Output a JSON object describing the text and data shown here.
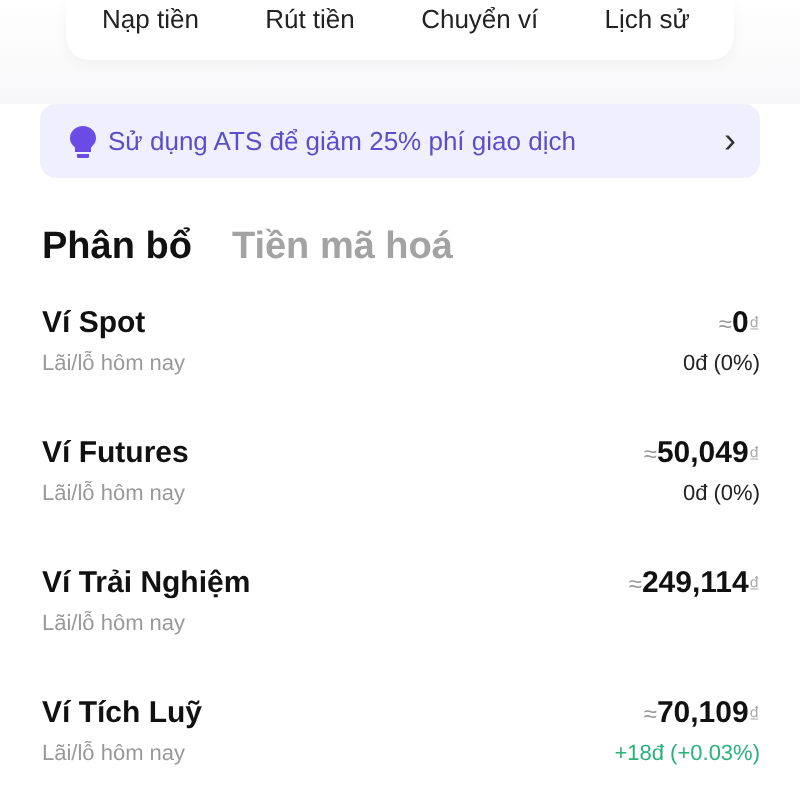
{
  "actions": [
    {
      "label": "Nạp tiền"
    },
    {
      "label": "Rút tiền"
    },
    {
      "label": "Chuyển ví"
    },
    {
      "label": "Lịch sử"
    }
  ],
  "banner": {
    "text": "Sử dụng ATS để giảm 25% phí giao dịch",
    "chevron": "›"
  },
  "tabs": [
    {
      "label": "Phân bổ",
      "selected": true
    },
    {
      "label": "Tiền mã hoá",
      "selected": false
    }
  ],
  "wallets": [
    {
      "name": "Ví Spot",
      "approx": "≈",
      "amount": "0",
      "currency": "₫",
      "pnl_label": "Lãi/lỗ hôm nay",
      "pnl": "0đ (0%)",
      "kind": "neutral"
    },
    {
      "name": "Ví Futures",
      "approx": "≈",
      "amount": "50,049",
      "currency": "₫",
      "pnl_label": "Lãi/lỗ hôm nay",
      "pnl": "0đ (0%)",
      "kind": "neutral"
    },
    {
      "name": "Ví Trải Nghiệm",
      "approx": "≈",
      "amount": "249,114",
      "currency": "₫",
      "pnl_label": "Lãi/lỗ hôm nay"
    },
    {
      "name": "Ví Tích Luỹ",
      "approx": "≈",
      "amount": "70,109",
      "currency": "₫",
      "pnl_label": "Lãi/lỗ hôm nay",
      "pnl": "+18đ (+0.03%)",
      "kind": "gain"
    }
  ]
}
